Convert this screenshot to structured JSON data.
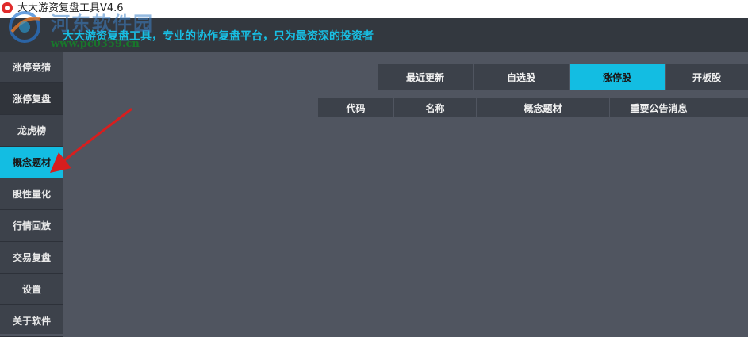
{
  "window": {
    "title": "大大游资复盘工具V4.6"
  },
  "banner": {
    "slogan": "大大游资复盘工具，专业的协作复盘平台，只为最资深的投资者"
  },
  "watermark": {
    "name": "河东软件园",
    "url": "www.pc0359.cn"
  },
  "sidebar": {
    "items": [
      {
        "label": "涨停竞猜"
      },
      {
        "label": "涨停复盘"
      },
      {
        "label": "龙虎榜"
      },
      {
        "label": "概念题材"
      },
      {
        "label": "股性量化"
      },
      {
        "label": "行情回放"
      },
      {
        "label": "交易复盘"
      },
      {
        "label": "设置"
      },
      {
        "label": "关于软件"
      }
    ],
    "active": "概念题材"
  },
  "tabs": {
    "items": [
      {
        "label": "最近更新"
      },
      {
        "label": "自选股"
      },
      {
        "label": "涨停股"
      },
      {
        "label": "开板股"
      }
    ],
    "active": "涨停股"
  },
  "table": {
    "columns": [
      {
        "label": "代码"
      },
      {
        "label": "名称"
      },
      {
        "label": "概念题材"
      },
      {
        "label": "重要公告消息"
      }
    ],
    "rows": []
  },
  "colors": {
    "accent": "#13bde2",
    "background": "#505560",
    "sidebar": "#3d424b",
    "banner": "#33383f",
    "annotation_arrow": "#d81e1e"
  }
}
